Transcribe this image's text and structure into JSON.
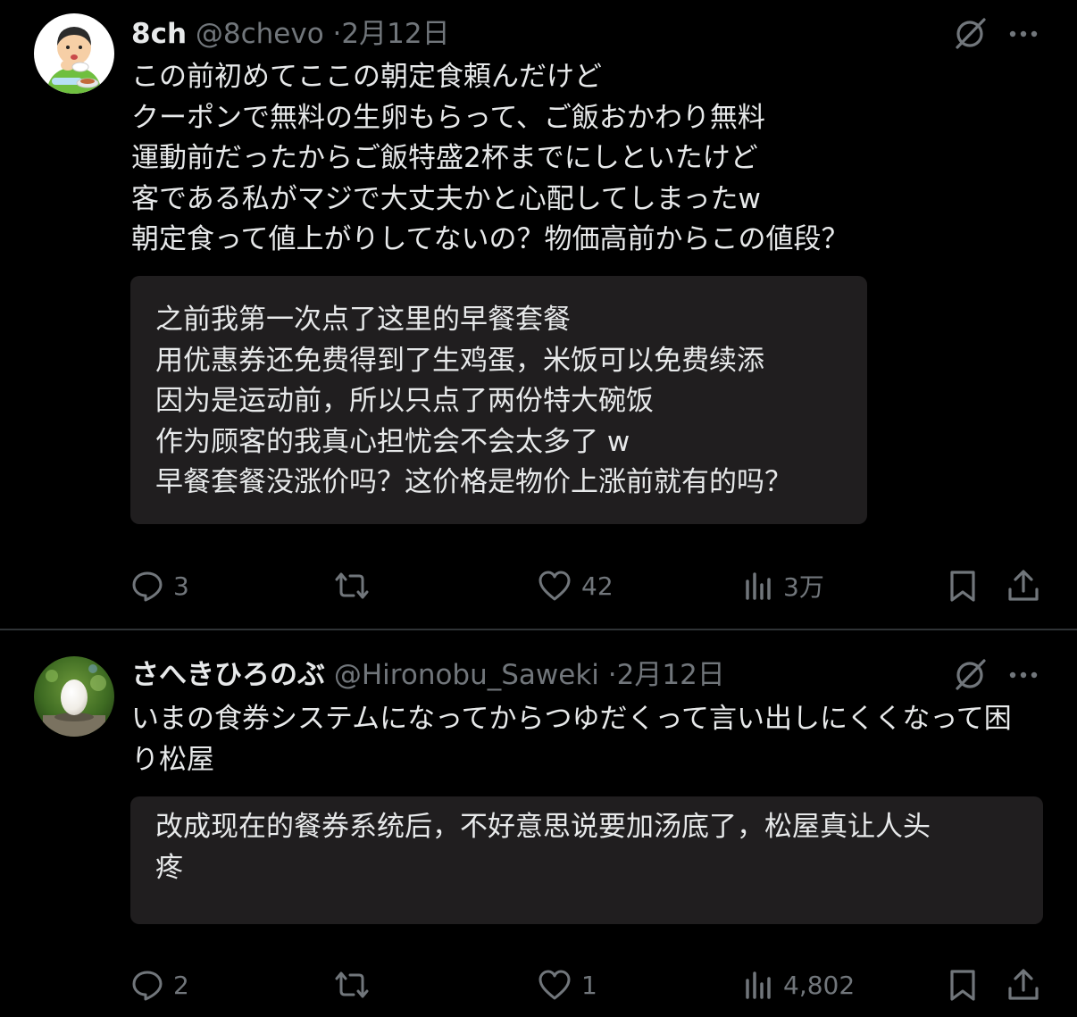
{
  "posts": [
    {
      "author": {
        "name": "8ch",
        "handle": "@8chevo",
        "separator": "·",
        "date": "2月12日"
      },
      "avatar": {
        "icon": "avatar-man-eating-illustration"
      },
      "text_lines": [
        "この前初めてここの朝定食頼んだけど",
        "クーポンで無料の生卵もらって、ご飯おかわり無料",
        "運動前だったからご飯特盛2杯までにしといたけど",
        "客である私がマジで大丈夫かと心配してしまったw",
        "朝定食って値上がりしてないの？物価高前からこの値段？"
      ],
      "translation_lines": [
        "之前我第一次点了这里的早餐套餐",
        "用优惠券还免费得到了生鸡蛋，米饭可以免费续添",
        "因为是运动前，所以只点了两份特大碗饭",
        "作为顾客的我真心担忧会不会太多了 w",
        "早餐套餐没涨价吗？这价格是物价上涨前就有的吗？"
      ],
      "metrics": {
        "replies": "3",
        "reposts": "",
        "likes": "42",
        "views": "3万"
      }
    },
    {
      "author": {
        "name": "さへきひろのぶ",
        "handle": "@Hironobu_Saweki",
        "separator": "·",
        "date": "2月12日"
      },
      "avatar": {
        "icon": "avatar-egg-photo"
      },
      "text_lines": [
        "いまの食券システムになってからつゆだくって言い出しにくくなって困",
        "り松屋"
      ],
      "translation_lines": [
        "改成现在的餐券系统后，不好意思说要加汤底了，松屋真让人头",
        "疼"
      ],
      "metrics": {
        "replies": "2",
        "reposts": "",
        "likes": "1",
        "views": "4,802"
      }
    }
  ],
  "icons": {
    "grok": "grok-slash-icon",
    "more": "more-dots-icon",
    "reply": "reply-bubble-icon",
    "repost": "repost-icon",
    "like": "heart-icon",
    "views": "views-bar-chart-icon",
    "bookmark": "bookmark-icon",
    "share": "share-upload-icon"
  },
  "colors": {
    "background": "#000000",
    "text_primary": "#e7e9ea",
    "text_secondary": "#71767b",
    "translation_box": "#201e1f",
    "divider": "#2f3336"
  }
}
